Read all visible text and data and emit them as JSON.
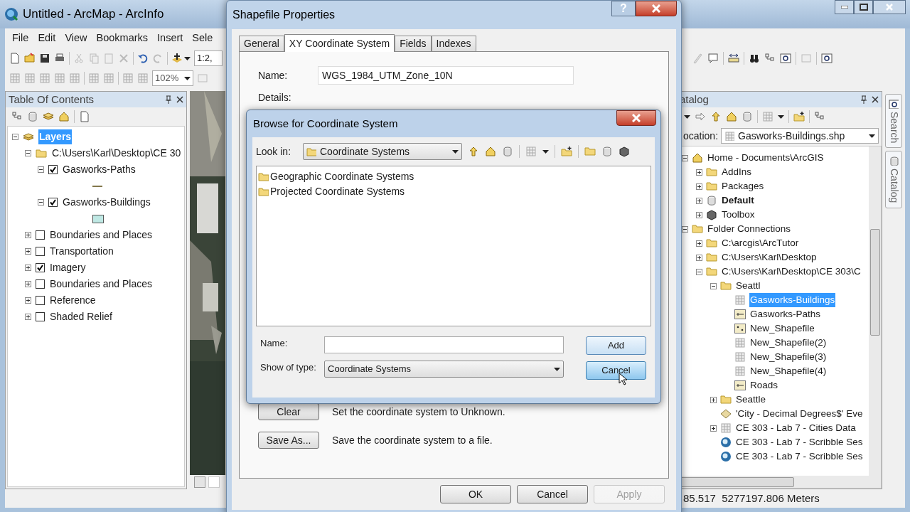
{
  "main_window": {
    "title": "Untitled - ArcMap - ArcInfo",
    "menu": [
      "File",
      "Edit",
      "View",
      "Bookmarks",
      "Insert",
      "Sele"
    ],
    "scale_field": "1:2,",
    "zoom_combo": "102%"
  },
  "toc": {
    "title": "Table Of Contents",
    "tree": [
      {
        "label": "Layers",
        "kind": "frame",
        "selected": true,
        "expanded": true,
        "children": [
          {
            "label": "C:\\Users\\Karl\\Desktop\\CE 30",
            "kind": "folder",
            "selected": false,
            "expanded": true,
            "children": [
              {
                "label": "Gasworks-Paths",
                "kind": "layer",
                "selected": false,
                "checked": true,
                "expanded": true,
                "legend": {
                  "kind": "line"
                }
              },
              {
                "label": "Gasworks-Buildings",
                "kind": "layer",
                "selected": false,
                "checked": true,
                "expanded": true,
                "legend": {
                  "kind": "polygon"
                }
              }
            ]
          },
          {
            "label": "Boundaries and Places",
            "kind": "layer",
            "selected": false,
            "checked": false,
            "expanded": false
          },
          {
            "label": "Transportation",
            "kind": "layer",
            "selected": false,
            "checked": false,
            "expanded": false
          },
          {
            "label": "Imagery",
            "kind": "layer",
            "selected": false,
            "checked": true,
            "expanded": false
          },
          {
            "label": "Boundaries and Places",
            "kind": "layer",
            "selected": false,
            "checked": false,
            "expanded": false
          },
          {
            "label": "Reference",
            "kind": "layer",
            "selected": false,
            "checked": false,
            "expanded": false
          },
          {
            "label": "Shaded Relief",
            "kind": "layer",
            "selected": false,
            "checked": false,
            "expanded": false
          }
        ]
      }
    ]
  },
  "catalog": {
    "title": "atalog",
    "location_label": "ocation:",
    "location": "Gasworks-Buildings.shp",
    "side_tabs": [
      "Search",
      "Catalog"
    ],
    "tree": [
      {
        "label": "Home - Documents\\ArcGIS",
        "kind": "home",
        "selected": false,
        "expanded": true,
        "children": [
          {
            "label": "AddIns",
            "kind": "folder",
            "selected": false,
            "expanded": false
          },
          {
            "label": "Packages",
            "kind": "folder",
            "selected": false,
            "expanded": false
          },
          {
            "label": "Default",
            "kind": "database",
            "selected": false,
            "expanded": false
          },
          {
            "label": "Toolbox",
            "kind": "toolbox",
            "selected": false,
            "expanded": false
          }
        ]
      },
      {
        "label": "Folder Connections",
        "kind": "connections",
        "selected": false,
        "expanded": true,
        "children": [
          {
            "label": "C:\\arcgis\\ArcTutor",
            "kind": "folder",
            "selected": false,
            "expanded": false
          },
          {
            "label": "C:\\Users\\Karl\\Desktop",
            "kind": "folder",
            "selected": false,
            "expanded": false
          },
          {
            "label": "C:\\Users\\Karl\\Desktop\\CE 303\\C",
            "kind": "folder",
            "selected": false,
            "expanded": true,
            "children": [
              {
                "label": "Seattl",
                "kind": "folder",
                "selected": false,
                "expanded": true,
                "children": [
                  {
                    "label": "Gasworks-Buildings",
                    "kind": "polygon",
                    "selected": true
                  },
                  {
                    "label": "Gasworks-Paths",
                    "kind": "line",
                    "selected": false
                  },
                  {
                    "label": "New_Shapefile",
                    "kind": "point",
                    "selected": false
                  },
                  {
                    "label": "New_Shapefile(2)",
                    "kind": "polygon",
                    "selected": false
                  },
                  {
                    "label": "New_Shapefile(3)",
                    "kind": "polygon",
                    "selected": false
                  },
                  {
                    "label": "New_Shapefile(4)",
                    "kind": "polygon",
                    "selected": false
                  },
                  {
                    "label": "Roads",
                    "kind": "line",
                    "selected": false
                  }
                ]
              },
              {
                "label": "Seattle",
                "kind": "folder",
                "selected": false,
                "expanded": false
              },
              {
                "label": "'City - Decimal Degrees$' Eve",
                "kind": "event",
                "selected": false
              },
              {
                "label": "CE 303 - Lab 7 - Cities Data",
                "kind": "table",
                "selected": false,
                "expanded": false
              },
              {
                "label": "CE 303 - Lab 7 - Scribble Ses",
                "kind": "map",
                "selected": false
              },
              {
                "label": "CE 303 - Lab 7 - Scribble Ses",
                "kind": "map",
                "selected": false
              }
            ]
          }
        ]
      }
    ]
  },
  "status_bar": "85.517  5277197.806 Meters",
  "properties_dialog": {
    "title": "Shapefile Properties",
    "help_button": "?",
    "tabs": [
      {
        "label": "General",
        "selected": false
      },
      {
        "label": "XY Coordinate System",
        "selected": true
      },
      {
        "label": "Fields",
        "selected": false
      },
      {
        "label": "Indexes",
        "selected": false
      }
    ],
    "name_label": "Name:",
    "name_value": "WGS_1984_UTM_Zone_10N",
    "details_label": "Details:",
    "actions": [
      {
        "button": "Clear",
        "description": "Set the coordinate system to Unknown."
      },
      {
        "button": "Save As...",
        "description": "Save the coordinate system to a file."
      }
    ],
    "buttons": [
      {
        "label": "OK",
        "disabled": false
      },
      {
        "label": "Cancel",
        "disabled": false
      },
      {
        "label": "Apply",
        "disabled": true
      }
    ]
  },
  "browse_dialog": {
    "title": "Browse for Coordinate System",
    "look_in_label": "Look in:",
    "look_in": "Coordinate Systems",
    "items": [
      "Geographic Coordinate Systems",
      "Projected Coordinate Systems"
    ],
    "name_label": "Name:",
    "type_label": "Show of type:",
    "type_value": "Coordinate Systems",
    "buttons": [
      {
        "label": "Add",
        "hovered": false
      },
      {
        "label": "Cancel",
        "hovered": true
      }
    ]
  }
}
